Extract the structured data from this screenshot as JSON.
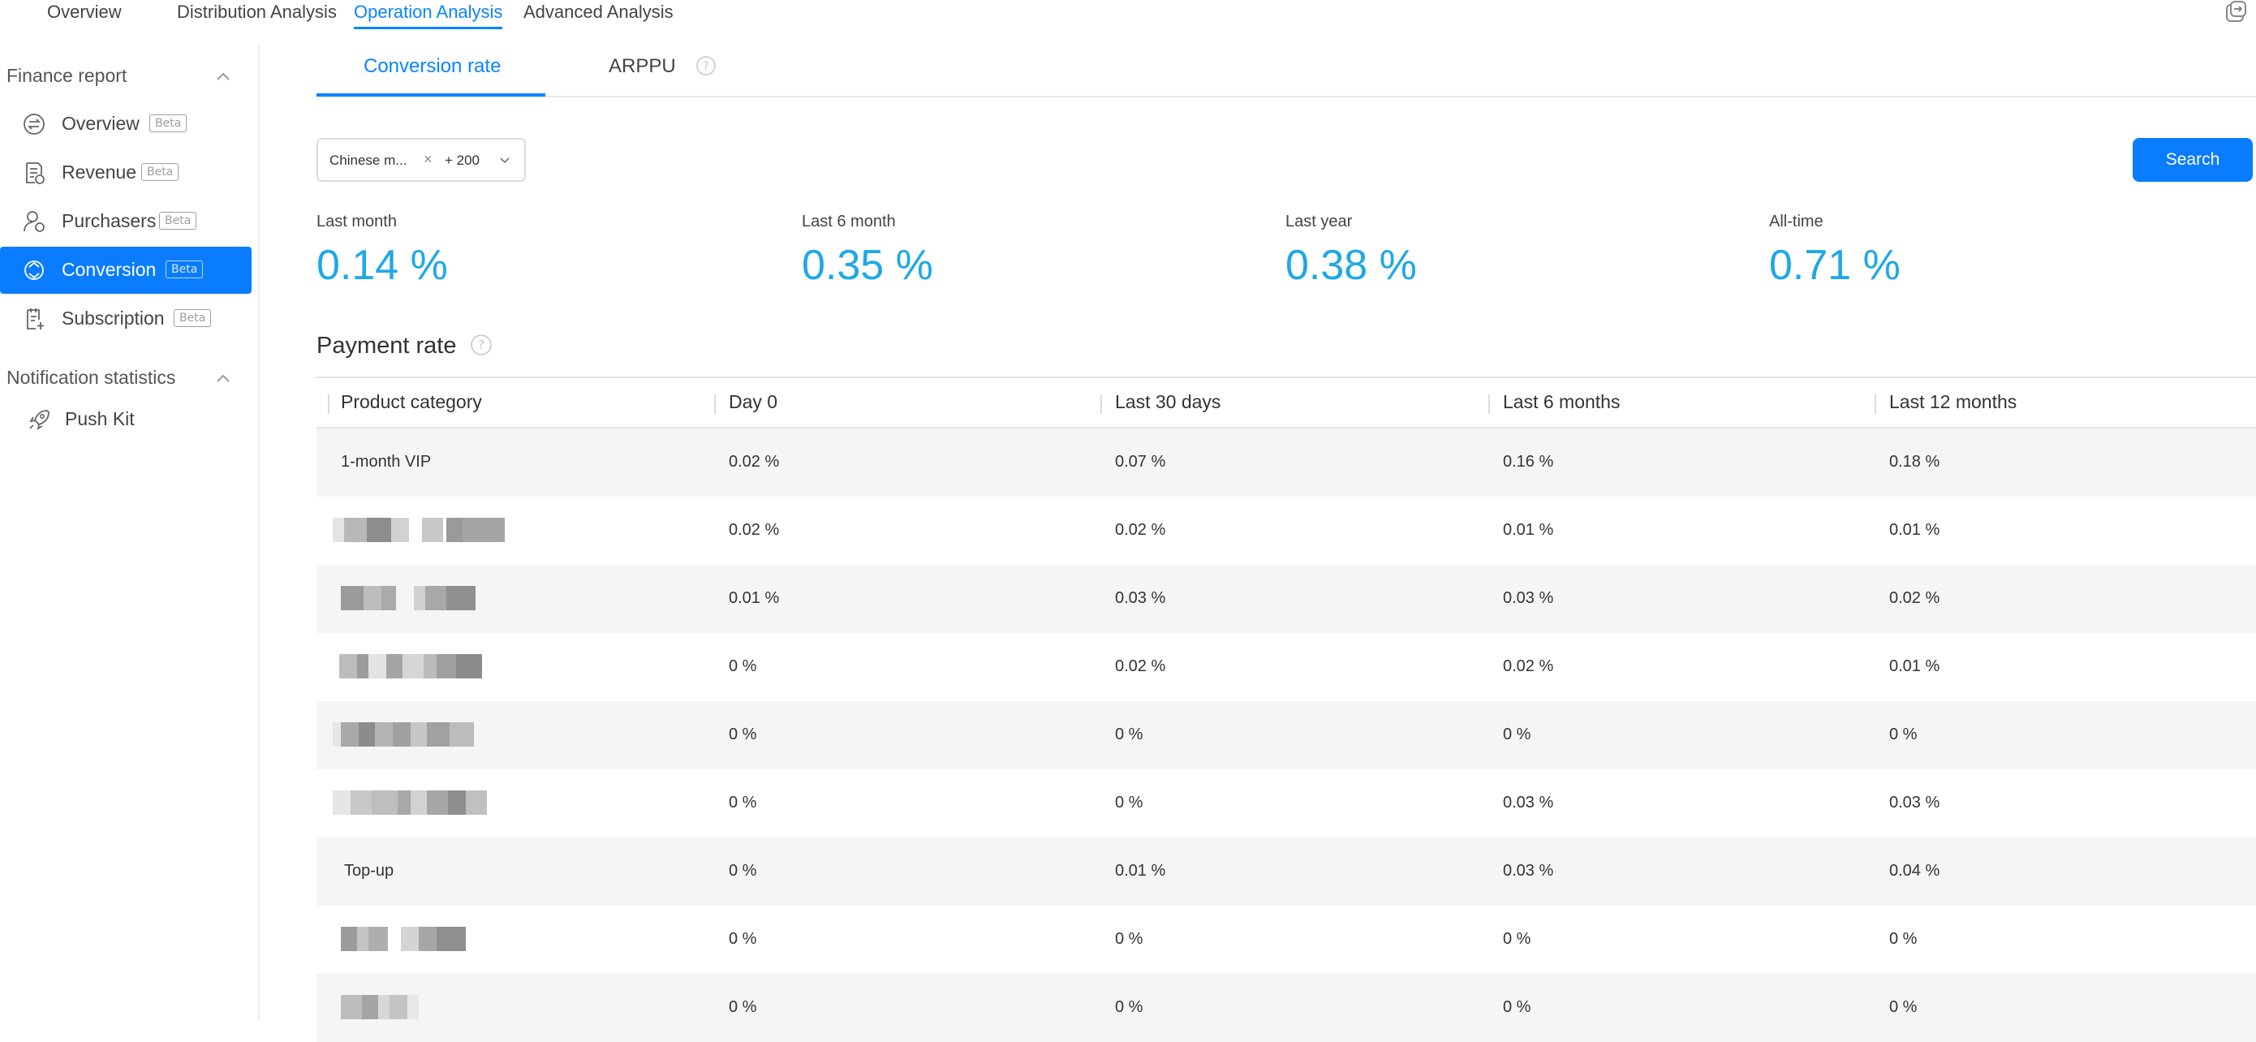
{
  "top_tabs": [
    {
      "label": "Overview",
      "active": false
    },
    {
      "label": "Distribution Analysis",
      "active": false
    },
    {
      "label": "Operation Analysis",
      "active": true
    },
    {
      "label": "Advanced Analysis",
      "active": false
    }
  ],
  "sidebar": {
    "finance_header": "Finance report",
    "items": [
      {
        "label": "Overview",
        "badge": "Beta",
        "icon": "exchange-icon",
        "active": false
      },
      {
        "label": "Revenue",
        "badge": "Beta",
        "icon": "revenue-document-icon",
        "active": false
      },
      {
        "label": "Purchasers",
        "badge": "Beta",
        "icon": "purchasers-user-icon",
        "active": false
      },
      {
        "label": "Conversion",
        "badge": "Beta",
        "icon": "conversion-icon",
        "active": true
      },
      {
        "label": "Subscription",
        "badge": "Beta",
        "icon": "subscription-document-icon",
        "active": false
      }
    ],
    "notification_header": "Notification statistics",
    "notification_items": [
      {
        "label": "Push Kit",
        "icon": "rocket-icon"
      }
    ]
  },
  "subtabs": [
    {
      "label": "Conversion rate",
      "active": true
    },
    {
      "label": "ARPPU",
      "active": false
    }
  ],
  "filter": {
    "tag": "Chinese m...",
    "more": "+ 200"
  },
  "search_label": "Search",
  "kpis": [
    {
      "label": "Last month",
      "value": "0.14 %"
    },
    {
      "label": "Last 6 month",
      "value": "0.35 %"
    },
    {
      "label": "Last year",
      "value": "0.38 %"
    },
    {
      "label": "All-time",
      "value": "0.71 %"
    }
  ],
  "payment_rate": {
    "title": "Payment rate",
    "columns": [
      "Product category",
      "Day 0",
      "Last 30 days",
      "Last 6 months",
      "Last 12 months"
    ],
    "rows": [
      {
        "name": "1-month VIP",
        "values": [
          "0.02 %",
          "0.07 %",
          "0.16 %",
          "0.18 %"
        ]
      },
      {
        "name": "",
        "values": [
          "0.02 %",
          "0.02 %",
          "0.01 %",
          "0.01 %"
        ]
      },
      {
        "name": "",
        "values": [
          "0.01 %",
          "0.03 %",
          "0.03 %",
          "0.02 %"
        ]
      },
      {
        "name": "",
        "values": [
          "0 %",
          "0.02 %",
          "0.02 %",
          "0.01 %"
        ]
      },
      {
        "name": "",
        "values": [
          "0 %",
          "0 %",
          "0 %",
          "0 %"
        ]
      },
      {
        "name": "",
        "values": [
          "0 %",
          "0 %",
          "0.03 %",
          "0.03 %"
        ]
      },
      {
        "name": "Top-up",
        "values": [
          "0 %",
          "0.01 %",
          "0.03 %",
          "0.04 %"
        ]
      },
      {
        "name": "",
        "values": [
          "0 %",
          "0 %",
          "0 %",
          "0 %"
        ]
      },
      {
        "name": "",
        "values": [
          "0 %",
          "0 %",
          "0 %",
          "0 %"
        ]
      }
    ]
  },
  "colors": {
    "accent": "#0a7cff",
    "kpi_value": "#1ea8e8",
    "row_shade": "#f5f5f5"
  }
}
